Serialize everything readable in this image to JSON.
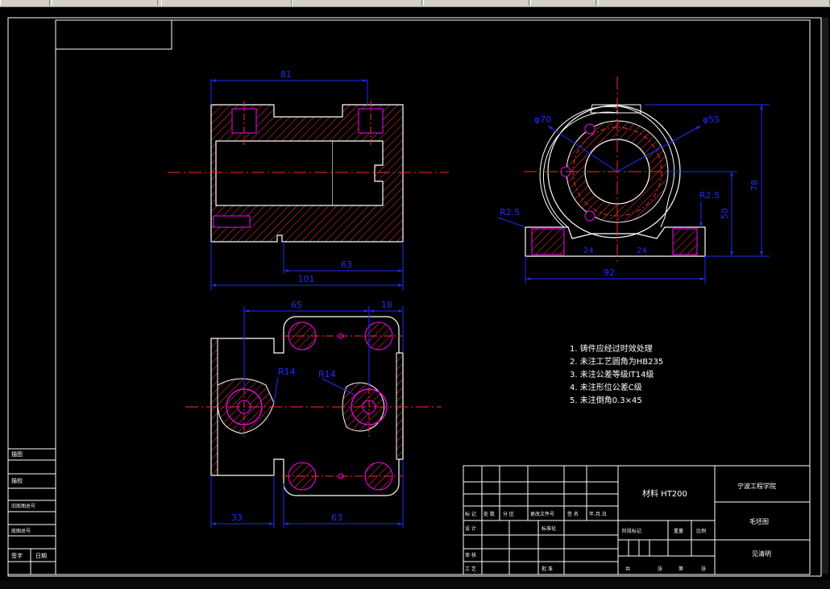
{
  "colors": {
    "background": "#000000",
    "frame": "#ffffff",
    "outline": "#ffffff",
    "hatch": "#ff3b3b",
    "centerline": "#ff2a2a",
    "dimension": "#1e2cff",
    "hidden": "#ff00ff",
    "notes": "#ffffff"
  },
  "dims": {
    "top_81": "81",
    "top_63": "63",
    "top_101": "101",
    "phi70": "φ70",
    "r55": "φ55",
    "h78": "78",
    "h50": "50",
    "r25_left": "R2.5",
    "r25_right": "R2.5",
    "b24_left": "24",
    "b24_right": "24",
    "w92": "92",
    "d65": "65",
    "d18": "18",
    "r14_left": "R14",
    "r14_right": "R14",
    "b33": "33",
    "b63": "63"
  },
  "notes": [
    "1. 铸件应经过时效处理",
    "2. 未注工艺圆角为HB235",
    "3. 未注公差等级IT14级",
    "4. 未注形位公差C级",
    "5. 未注倒角0.3×45"
  ],
  "title_block": {
    "material": "材料 HT200",
    "school": "宁波工程学院",
    "part_name": "毛坯图",
    "designer": "见清明",
    "labels_row": [
      "标 记",
      "处 数",
      "分 区",
      "更改文件号",
      "签 名",
      "年.月.日"
    ],
    "design": "设 计",
    "standard": "标准化",
    "check": "审 核",
    "process": "工 艺",
    "approve": "批 准",
    "stage": "阶段标记",
    "weight": "重量",
    "scale": "比例",
    "sheet_total": "共",
    "sheet_n": "张",
    "sheet_this": "第"
  },
  "side_block": {
    "labels": [
      "描图",
      "描校",
      "旧底图总号",
      "底图总号",
      "签字",
      "日期"
    ]
  }
}
